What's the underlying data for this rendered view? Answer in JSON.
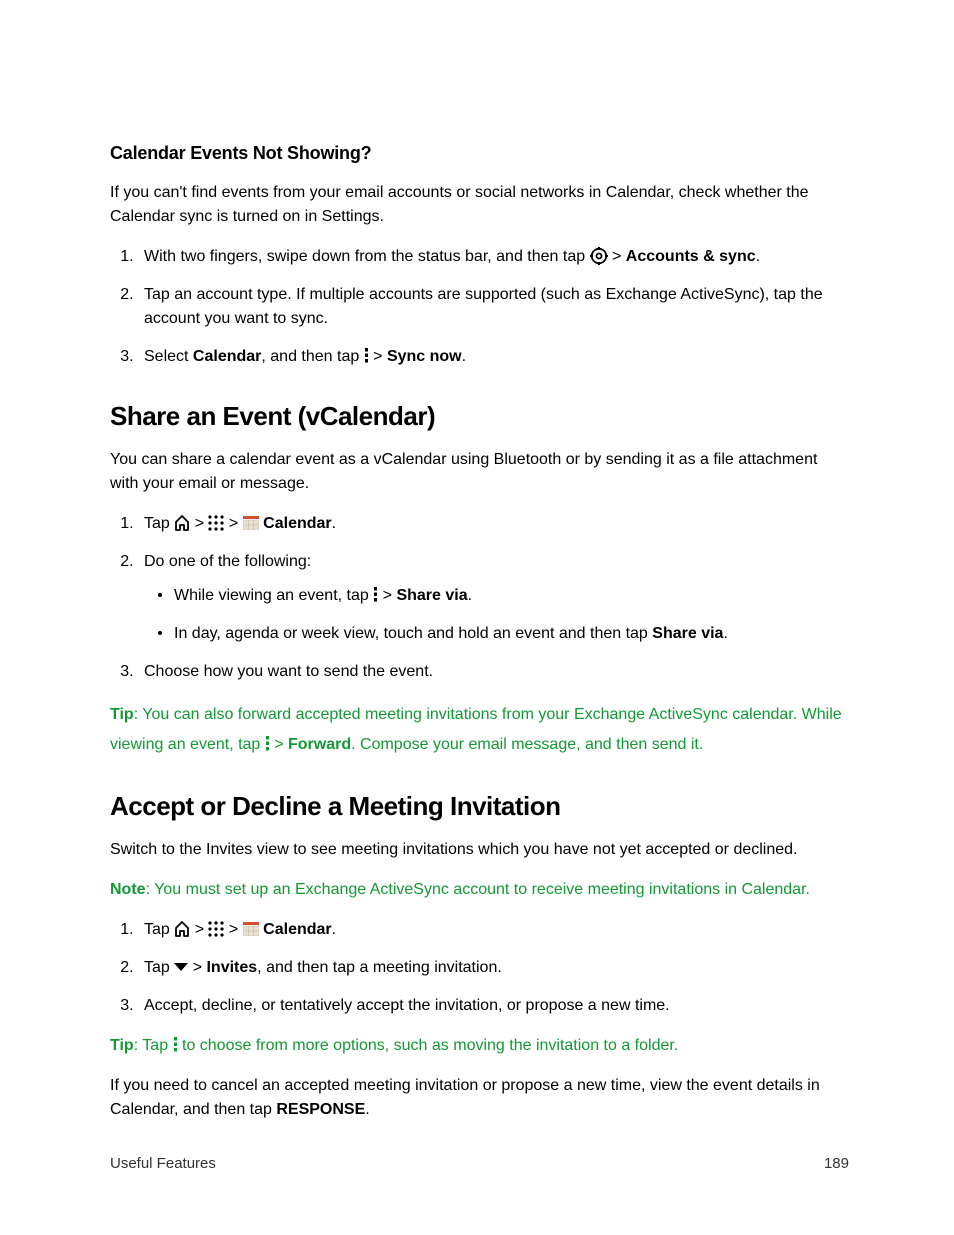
{
  "section1": {
    "heading": "Calendar Events Not Showing?",
    "intro": "If you can't find events from your email accounts or social networks in Calendar, check whether the Calendar sync is turned on in Settings.",
    "step1_a": "With two fingers, swipe down from the status bar, and then tap ",
    "step1_b": " > ",
    "step1_bold": "Accounts & sync",
    "step1_c": ".",
    "step2": "Tap an account type. If multiple accounts are supported (such as Exchange ActiveSync), tap the account you want to sync.",
    "step3_a": "Select ",
    "step3_bold1": "Calendar",
    "step3_b": ", and then tap ",
    "step3_c": " > ",
    "step3_bold2": "Sync now",
    "step3_d": "."
  },
  "section2": {
    "heading": "Share an Event (vCalendar)",
    "intro": "You can share a calendar event as a vCalendar using Bluetooth or by sending it as a file attachment with your email or message.",
    "step1_a": "Tap ",
    "step1_b": " > ",
    "step1_c": " > ",
    "step1_d": " ",
    "step1_bold": "Calendar",
    "step1_e": ".",
    "step2": "Do one of the following:",
    "bullet1_a": "While viewing an event, tap ",
    "bullet1_b": " > ",
    "bullet1_bold": "Share via",
    "bullet1_c": ".",
    "bullet2_a": "In day, agenda or week view, touch and hold an event and then tap ",
    "bullet2_bold": "Share via",
    "bullet2_b": ".",
    "step3": "Choose how you want to send the event.",
    "tip_label": "Tip",
    "tip_a": ": You can also forward accepted meeting invitations from your Exchange ActiveSync calendar. While viewing an event, tap ",
    "tip_b": " > ",
    "tip_bold": "Forward",
    "tip_c": ". Compose your email message, and then send it."
  },
  "section3": {
    "heading": "Accept or Decline a Meeting Invitation",
    "intro": "Switch to the Invites view to see meeting invitations which you have not yet accepted or declined.",
    "note_label": "Note",
    "note_text": ": You must set up an Exchange ActiveSync account to receive meeting invitations in Calendar.",
    "step1_a": "Tap ",
    "step1_b": " > ",
    "step1_c": " > ",
    "step1_d": " ",
    "step1_bold": "Calendar",
    "step1_e": ".",
    "step2_a": "Tap ",
    "step2_b": " > ",
    "step2_bold": "Invites",
    "step2_c": ", and then tap a meeting invitation.",
    "step3": "Accept, decline, or tentatively accept the invitation, or propose a new time.",
    "tip_label": "Tip",
    "tip_a": ": Tap ",
    "tip_b": " to choose from more options, such as moving the invitation to a folder.",
    "outro_a": "If you need to cancel an accepted meeting invitation or propose a new time, view the event details in Calendar, and then tap ",
    "outro_bold": "RESPONSE",
    "outro_b": "."
  },
  "footer": {
    "left": "Useful Features",
    "right": "189"
  }
}
